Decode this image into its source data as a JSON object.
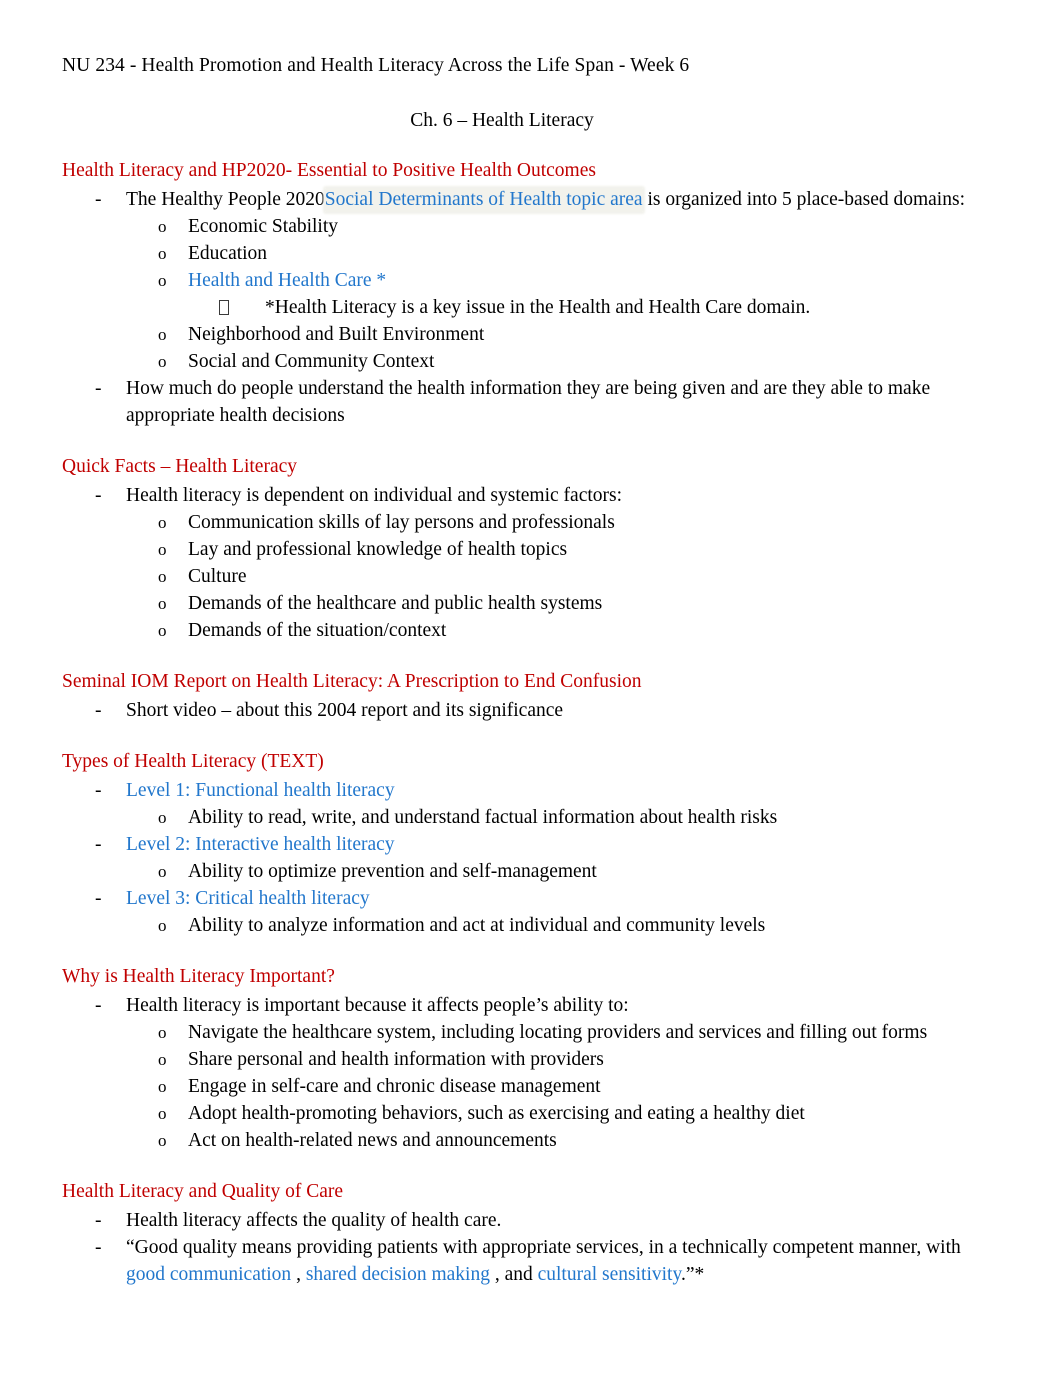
{
  "document": {
    "header": "NU 234 - Health Promotion and Health Literacy Across the Life Span - Week 6",
    "subtitle": "Ch. 6 – Health Literacy"
  },
  "colors": {
    "heading_red": "#C00000",
    "link_blue": "#2277CC",
    "link_blue_dark": "#2E74B5",
    "highlight": "#F2F2EC",
    "body_text": "#000000"
  },
  "markers": {
    "dash": "-",
    "circle": "o",
    "box": "▯"
  },
  "sections": [
    {
      "heading": "Health Literacy and HP2020- Essential to Positive Health Outcomes",
      "items": {
        "b1_pre": "The Healthy People 2020",
        "b1_link": "Social Determinants of Health topic area",
        "b1_post": " is organized into 5 place-based domains:",
        "d1": "Economic Stability",
        "d2": "Education",
        "d3_link": "Health and Health Care *",
        "d3_note": "*Health Literacy is a key issue in the Health and Health Care domain.",
        "d4": "Neighborhood and Built Environment",
        "d5": "Social and Community Context",
        "b2": "How much do people understand the health information they are being given and are they able to make appropriate health decisions"
      }
    },
    {
      "heading": "Quick Facts – Health Literacy",
      "items": {
        "b1": "Health literacy is dependent on individual and systemic factors:",
        "f1": "Communication skills of lay persons and professionals",
        "f2": "Lay and professional knowledge of health topics",
        "f3": "Culture",
        "f4": "Demands of the healthcare and public health systems",
        "f5": "Demands of the situation/context"
      }
    },
    {
      "heading": "Seminal IOM Report on Health Literacy: A Prescription to End Confusion",
      "items": {
        "b1": "Short video – about this 2004 report and its significance"
      }
    },
    {
      "heading": "Types of Health Literacy (TEXT)",
      "items": {
        "l1_link": "Level 1: Functional health literacy",
        "l1_sub": "Ability to read, write, and understand factual information about health risks",
        "l2_link": "Level 2: Interactive health literacy",
        "l2_sub": "Ability to optimize prevention and self-management",
        "l3_link": "Level 3: Critical health literacy",
        "l3_sub": "Ability to analyze information and act at individual and community levels"
      }
    },
    {
      "heading": "Why is Health Literacy Important?",
      "items": {
        "b1": "Health literacy is important because it affects people’s ability to:",
        "w1": "Navigate the healthcare system, including locating providers and services and filling out forms",
        "w2": "Share personal and health information with providers",
        "w3": "Engage in self-care and chronic disease management",
        "w4": "Adopt health-promoting behaviors, such as exercising and eating a healthy diet",
        "w5": "Act on health-related news and announcements"
      }
    },
    {
      "heading": "Health Literacy and Quality of Care",
      "items": {
        "b1": "Health literacy affects the quality of health care.",
        "q_pre": "“Good quality means providing patients with appropriate services, in a technically competent manner, with ",
        "q_link1": "good communication",
        "q_sep1": " , ",
        "q_link2": "shared",
        "q_gap": "  ",
        "q_link3": "decision making",
        "q_sep2": " , and ",
        "q_link4": "cultural sensitivity",
        "q_post": ".”*"
      }
    }
  ]
}
